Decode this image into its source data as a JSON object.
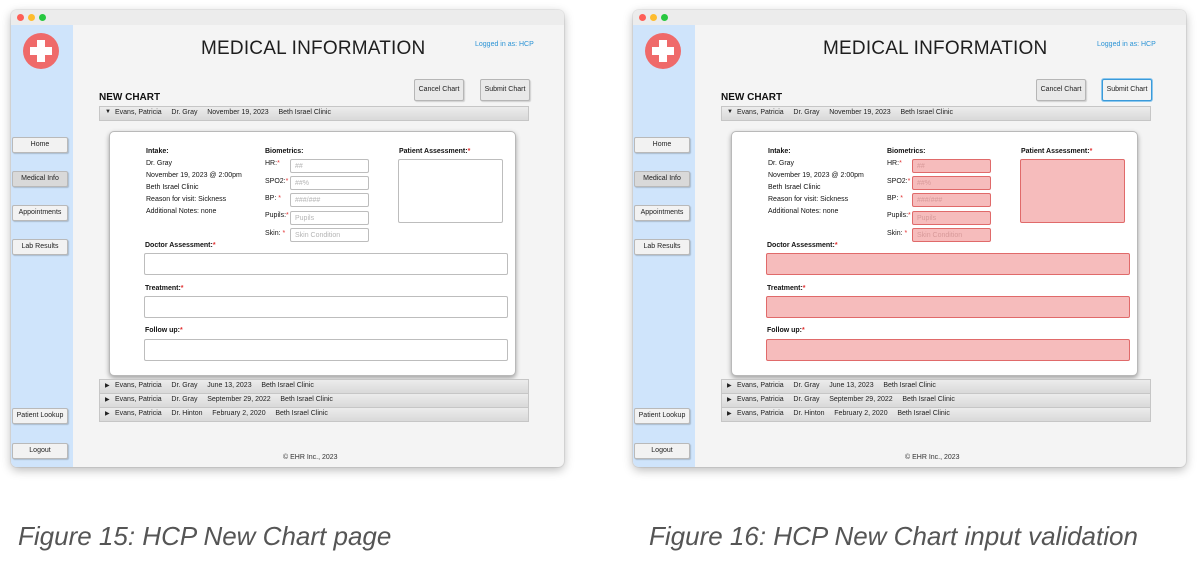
{
  "figures": [
    {
      "caption": "Figure 15: HCP New Chart page",
      "validation_state": "default"
    },
    {
      "caption": "Figure 16: HCP New Chart input validation",
      "validation_state": "invalid"
    }
  ],
  "app": {
    "title": "MEDICAL INFORMATION",
    "logged_in": "Logged in as: HCP",
    "footer": "© EHR Inc., 2023",
    "logo_icon": "medical-cross-icon",
    "accent_color": "#2a93d5",
    "sidebar_color": "#cfe4fb",
    "error_color": "#f6bcbc"
  },
  "sidebar": {
    "home": "Home",
    "medical_info": "Medical Info",
    "appointments": "Appointments",
    "lab_results": "Lab Results",
    "patient_lookup": "Patient Lookup",
    "logout": "Logout"
  },
  "toolbar": {
    "cancel": "Cancel Chart",
    "submit": "Submit Chart"
  },
  "section_title": "NEW CHART",
  "charts": [
    {
      "patient": "Evans, Patricia",
      "doctor": "Dr. Gray",
      "date": "November 19, 2023",
      "clinic": "Beth Israel Clinic",
      "expanded": true
    },
    {
      "patient": "Evans, Patricia",
      "doctor": "Dr. Gray",
      "date": "June 13, 2023",
      "clinic": "Beth Israel Clinic",
      "expanded": false
    },
    {
      "patient": "Evans, Patricia",
      "doctor": "Dr. Gray",
      "date": "September 29, 2022",
      "clinic": "Beth Israel Clinic",
      "expanded": false
    },
    {
      "patient": "Evans, Patricia",
      "doctor": "Dr. Hinton",
      "date": "February 2, 2020",
      "clinic": "Beth Israel Clinic",
      "expanded": false
    }
  ],
  "intake": {
    "label": "Intake:",
    "doctor": "Dr. Gray",
    "datetime": "November 19, 2023 @ 2:00pm",
    "clinic": "Beth Israel Clinic",
    "reason": "Reason for visit: Sickness",
    "notes": "Additional Notes: none"
  },
  "biometrics": {
    "label": "Biometrics:",
    "hr_label": "HR:",
    "hr_placeholder": "##",
    "spo2_label": "SPO2:",
    "spo2_placeholder": "##%",
    "bp_label": "BP:",
    "bp_placeholder": "###/###",
    "pupils_label": "Pupils:",
    "pupils_placeholder": "Pupils",
    "skin_label": "Skin:",
    "skin_placeholder": "Skin Condition"
  },
  "assessment": {
    "patient_label": "Patient Assessment:",
    "doctor_label": "Doctor Assessment:",
    "treatment_label": "Treatment:",
    "followup_label": "Follow up:"
  },
  "required_marker": "*"
}
